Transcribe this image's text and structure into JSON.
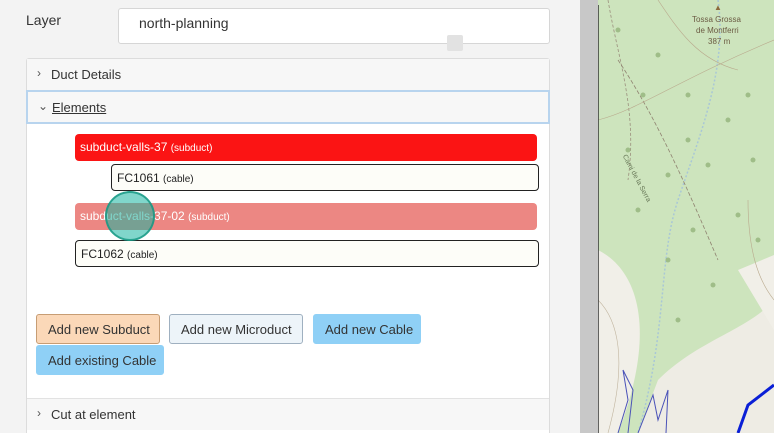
{
  "layer": {
    "label": "Layer",
    "value": "north-planning"
  },
  "sections": {
    "duct_details": {
      "label": "Duct Details",
      "chevron": "chevron-right-icon"
    },
    "elements": {
      "label": "Elements",
      "chevron": "chevron-down-icon"
    },
    "cut": {
      "label": "Cut at element",
      "chevron": "chevron-right-icon"
    }
  },
  "elements": [
    {
      "name": "subduct-valls-37",
      "type": "(subduct)"
    },
    {
      "name": "FC1061",
      "type": "(cable)"
    },
    {
      "name": "subduct-valls-37-02",
      "type": "(subduct)"
    },
    {
      "name": "FC1062",
      "type": "(cable)"
    }
  ],
  "buttons": {
    "add_subduct": "Add new Subduct",
    "add_microduct": "Add new Microduct",
    "add_cable": "Add new Cable",
    "add_existing": "Add existing Cable"
  },
  "map": {
    "peak_name_1": "Tossa Grossa",
    "peak_name_2": "de Montferri",
    "peak_elevation": "387 m",
    "path_label": "Cami de la Serra"
  },
  "colors": {
    "subduct_active": "#fb1414",
    "subduct_inactive": "#ec8783",
    "accent": "#8fd0f6",
    "focus_border": "#b8d4ee",
    "route": "#0a1fd6"
  }
}
